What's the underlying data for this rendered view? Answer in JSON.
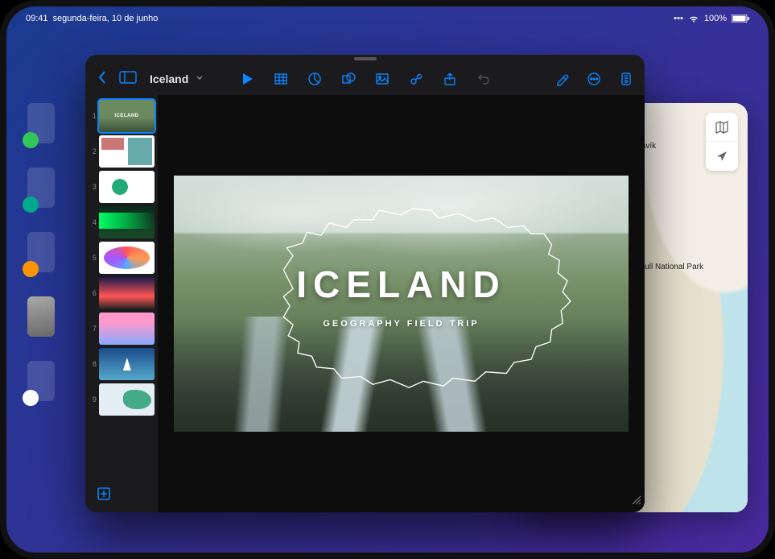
{
  "status": {
    "time": "09:41",
    "date": "segunda-feira, 10 de junho",
    "battery_pct": "100%"
  },
  "keynote": {
    "doc_title": "Iceland",
    "slide": {
      "title": "ICELAND",
      "subtitle": "GEOGRAPHY FIELD TRIP"
    },
    "thumb_count": 9,
    "selected_thumb": 1,
    "thumb_numbers": [
      "1",
      "2",
      "3",
      "4",
      "5",
      "6",
      "7",
      "8",
      "9"
    ]
  },
  "maps": {
    "place_1": "Húsavík",
    "place_2": "Vatnajökull National Park"
  },
  "icons": {
    "back": "chevron-left",
    "sidebar": "sidebar",
    "play": "play",
    "table": "table",
    "chart": "chart",
    "shape": "shape",
    "image": "image",
    "media": "media",
    "share": "share",
    "undo": "undo",
    "format_brush": "brush",
    "more": "ellipsis",
    "inspect": "inspector",
    "add": "plus",
    "map_mode": "map",
    "locate": "location"
  }
}
